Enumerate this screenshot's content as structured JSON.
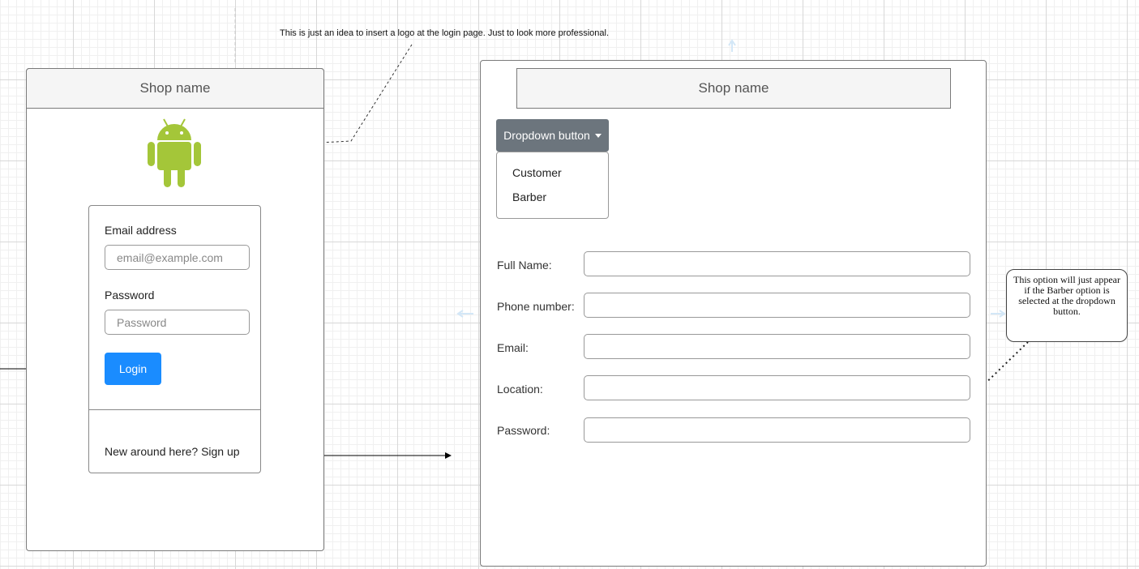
{
  "annotation": {
    "logo_note": "This is just an idea to insert a logo at the login page.  Just to look more professional.",
    "barber_note": "This option will just appear if the Barber option is selected at the dropdown button."
  },
  "login_screen": {
    "header_title": "Shop name",
    "logo_icon": "android-icon",
    "logo_color": "#a4c639",
    "email_label": "Email address",
    "email_placeholder": "email@example.com",
    "password_label": "Password",
    "password_placeholder": "Password",
    "login_button": "Login",
    "signup_text": "New around here? Sign up"
  },
  "signup_screen": {
    "header_title": "Shop name",
    "dropdown_label": "Dropdown button",
    "dropdown_options": [
      "Customer",
      "Barber"
    ],
    "fields": [
      {
        "label": "Full Name:"
      },
      {
        "label": "Phone number:"
      },
      {
        "label": "Email:"
      },
      {
        "label": "Location:"
      },
      {
        "label": "Password:"
      }
    ]
  },
  "colors": {
    "primary_button": "#1a8cff",
    "dropdown_button": "#6c757d",
    "header_background": "#f5f5f5"
  }
}
